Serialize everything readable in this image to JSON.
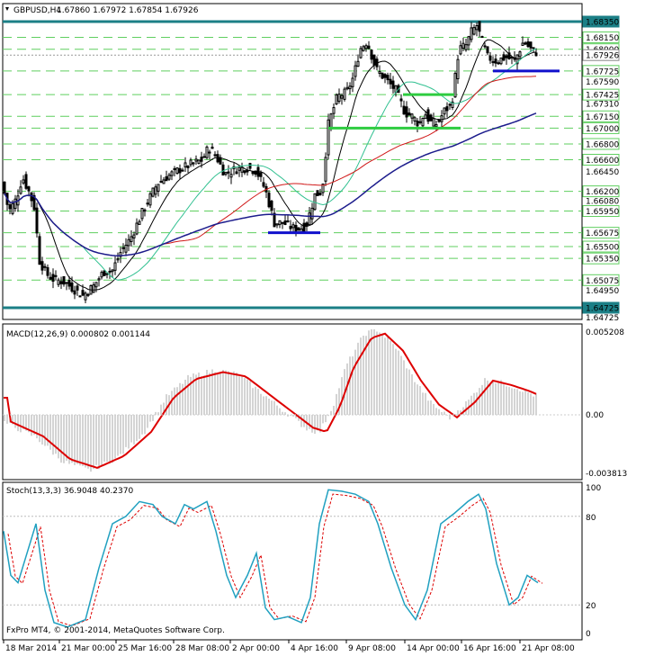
{
  "window": {
    "symbol_label": "GBPUSD,H4",
    "ohlc": [
      "1.67860",
      "1.67972",
      "1.67854",
      "1.67926"
    ],
    "copyright": "FxPro MT4, © 2001-2014, MetaQuotes Software Corp."
  },
  "indicators": {
    "macd_label": "MACD(12,26,9) 0.000802 0.001144",
    "stoch_label": "Stoch(13,3,3) 36.9048 40.2370"
  },
  "colors": {
    "background": "#ffffff",
    "candles": "#000000",
    "level_teal": "#1b7f86",
    "level_dashed": "#5fcf5f",
    "support_green": "#2ecc40",
    "support_blue": "#1010cc",
    "ma_black": "#000000",
    "ma_teal": "#30c090",
    "ma_red": "#d01818",
    "ma_navy": "#1c1c8c",
    "macd_signal": "#dd0000",
    "macd_hist": "#a8a8a8",
    "stoch_main": "#20a0c0",
    "stoch_signal": "#dd0000"
  },
  "price_axis": {
    "plain_labels": [
      "1.67590",
      "1.67310",
      "1.66450",
      "1.66080",
      "1.64950",
      "1.64725"
    ],
    "boxed_labels": [
      {
        "text": "1.68350",
        "kind": "teal"
      },
      {
        "text": "1.68150",
        "kind": "green"
      },
      {
        "text": "1.68000",
        "kind": "green"
      },
      {
        "text": "1.67926",
        "kind": "current"
      },
      {
        "text": "1.67725",
        "kind": "green"
      },
      {
        "text": "1.67425",
        "kind": "green"
      },
      {
        "text": "1.67150",
        "kind": "green"
      },
      {
        "text": "1.67000",
        "kind": "green"
      },
      {
        "text": "1.66800",
        "kind": "green"
      },
      {
        "text": "1.66600",
        "kind": "green"
      },
      {
        "text": "1.66200",
        "kind": "green"
      },
      {
        "text": "1.65950",
        "kind": "green"
      },
      {
        "text": "1.65675",
        "kind": "green"
      },
      {
        "text": "1.65500",
        "kind": "green"
      },
      {
        "text": "1.65350",
        "kind": "green"
      },
      {
        "text": "1.65075",
        "kind": "green"
      },
      {
        "text": "1.64725",
        "kind": "teal"
      }
    ]
  },
  "macd_axis": [
    "0.005208",
    "0.00",
    "-0.003813"
  ],
  "stoch_axis": [
    "100",
    "80",
    "20",
    "0"
  ],
  "time_axis": [
    "18 Mar 2014",
    "21 Mar 00:00",
    "25 Mar 16:00",
    "28 Mar 08:00",
    "2 Apr 00:00",
    "4 Apr 16:00",
    "9 Apr 08:00",
    "14 Apr 00:00",
    "16 Apr 16:00",
    "21 Apr 08:00"
  ]
}
